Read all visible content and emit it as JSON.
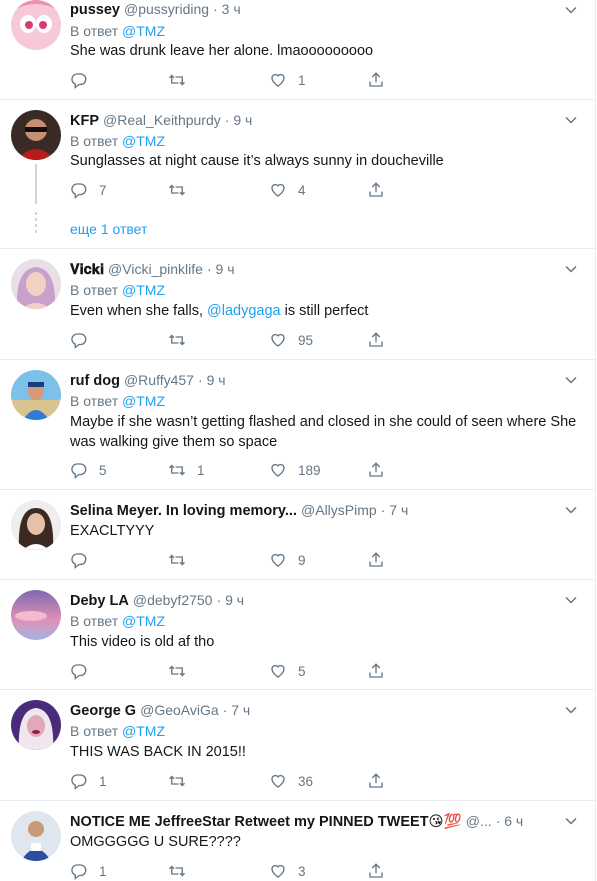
{
  "reply_label": "В ответ",
  "more_replies_label": "еще 1 ответ",
  "colors": {
    "accent": "#1da1f2",
    "muted": "#657786",
    "text": "#14171a",
    "divider": "#e6ecf0"
  },
  "tweets": [
    {
      "name": "pussey",
      "handle": "@pussyriding",
      "time": "3 ч",
      "reply_to": "@TMZ",
      "text": "She was drunk leave her alone. lmaooooooooo",
      "replies": "",
      "retweets": "",
      "likes": "1"
    },
    {
      "name": "KFP",
      "handle": "@Real_Keithpurdy",
      "time": "9 ч",
      "reply_to": "@TMZ",
      "text": "Sunglasses at night cause it’s always sunny in doucheville",
      "replies": "7",
      "retweets": "",
      "likes": "4"
    },
    {
      "name": "𝐕𝐢𝐜𝐤𝐢",
      "handle": "@Vicki_pinklife",
      "time": "9 ч",
      "reply_to": "@TMZ",
      "text_before": "Even when she falls, ",
      "text_mention": "@ladygaga",
      "text_after": " is still perfect",
      "replies": "",
      "retweets": "",
      "likes": "95"
    },
    {
      "name": "ruf dog",
      "handle": "@Ruffy457",
      "time": "9 ч",
      "reply_to": "@TMZ",
      "text": "Maybe if she wasn’t getting flashed and closed in she could of seen where She was walking give them so space",
      "replies": "5",
      "retweets": "1",
      "likes": "189"
    },
    {
      "name": "Selina Meyer. In loving memory...",
      "handle": "@AllysPimp",
      "time": "7 ч",
      "reply_to": "",
      "text": "EXACLTYYY",
      "replies": "",
      "retweets": "",
      "likes": "9"
    },
    {
      "name": "Deby LA",
      "handle": "@debyf2750",
      "time": "9 ч",
      "reply_to": "@TMZ",
      "text": "This video is old af tho",
      "replies": "",
      "retweets": "",
      "likes": "5"
    },
    {
      "name": "George G",
      "handle": "@GeoAviGa",
      "time": "7 ч",
      "reply_to": "@TMZ",
      "text": "THIS WAS BACK IN 2015!!",
      "replies": "1",
      "retweets": "",
      "likes": "36"
    },
    {
      "name": "NOTICE ME JeffreeStar Retweet my PINNED TWEET😘💯",
      "handle": "@...",
      "time": "6 ч",
      "reply_to": "",
      "text": "OMGGGGG U SURE????",
      "replies": "1",
      "retweets": "",
      "likes": "3"
    }
  ]
}
